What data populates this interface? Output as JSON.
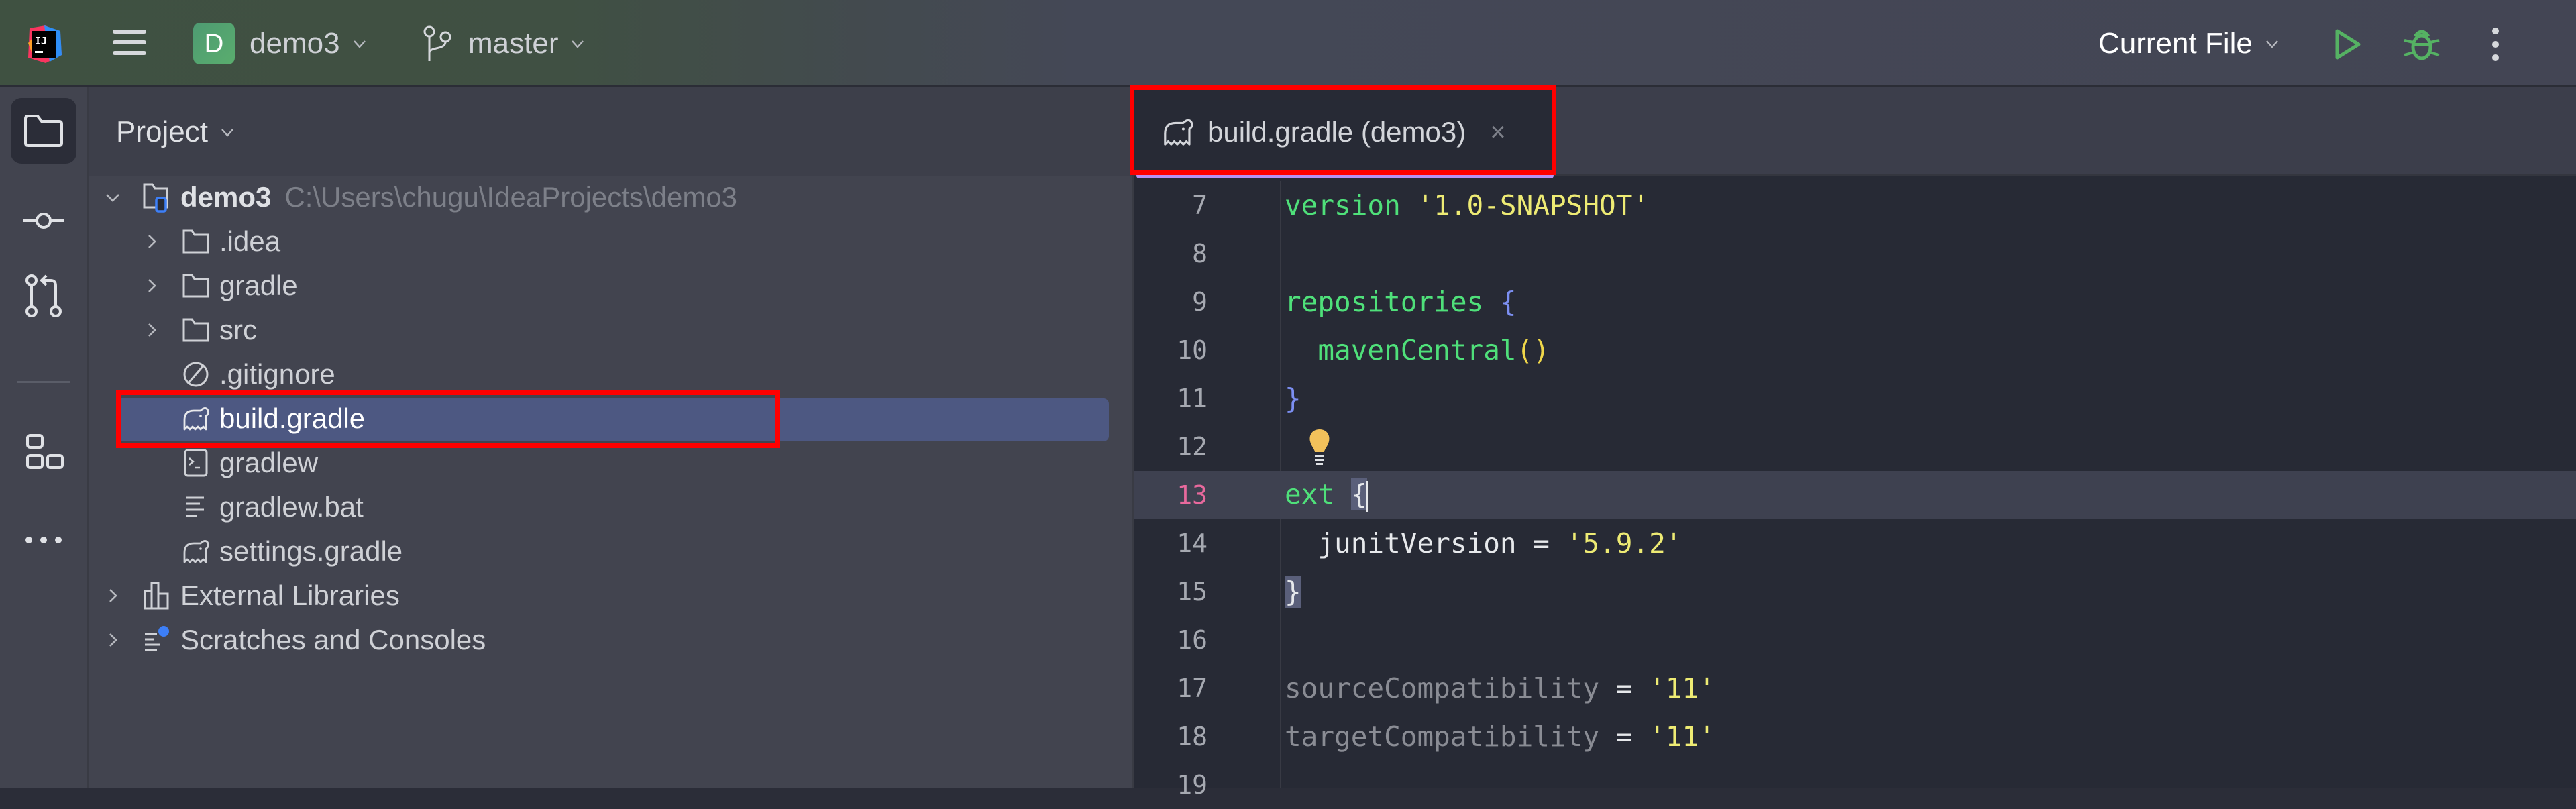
{
  "topbar": {
    "app_icon": "intellij-idea-logo",
    "menu_icon": "hamburger-menu-icon",
    "project": {
      "badge": "D",
      "name": "demo3",
      "badge_color": "#4e9b72"
    },
    "branch": {
      "icon": "git-branch-icon",
      "name": "master"
    },
    "run_config": {
      "label": "Current File"
    },
    "run_icon": "run-icon",
    "debug_icon": "debug-icon",
    "more_icon": "more-vertical-icon",
    "run_color": "#55b263"
  },
  "toolstrip": {
    "items": [
      {
        "name": "project",
        "icon": "folder-icon",
        "active": true
      },
      {
        "name": "commit",
        "icon": "commit-icon",
        "active": false
      },
      {
        "name": "pull-requests",
        "icon": "pull-request-icon",
        "active": false
      },
      {
        "name": "structure",
        "icon": "structure-icon",
        "active": false
      },
      {
        "name": "more",
        "icon": "more-horizontal-icon",
        "active": false
      }
    ]
  },
  "project_panel": {
    "title": "Project",
    "tree": [
      {
        "label": "demo3",
        "path": "C:\\Users\\chugu\\IdeaProjects\\demo3",
        "icon": "module-folder-icon",
        "expanded": true,
        "level": 0
      },
      {
        "label": ".idea",
        "icon": "folder-icon",
        "expandable": true,
        "level": 1
      },
      {
        "label": "gradle",
        "icon": "folder-icon",
        "expandable": true,
        "level": 1
      },
      {
        "label": "src",
        "icon": "folder-icon",
        "expandable": true,
        "level": 1
      },
      {
        "label": ".gitignore",
        "icon": "ignore-file-icon",
        "level": 1
      },
      {
        "label": "build.gradle",
        "icon": "gradle-icon",
        "level": 1,
        "selected": true
      },
      {
        "label": "gradlew",
        "icon": "shell-script-icon",
        "level": 1
      },
      {
        "label": "gradlew.bat",
        "icon": "text-file-icon",
        "level": 1
      },
      {
        "label": "settings.gradle",
        "icon": "gradle-icon",
        "level": 1
      },
      {
        "label": "External Libraries",
        "icon": "libraries-icon",
        "expandable": true,
        "level": 0
      },
      {
        "label": "Scratches and Consoles",
        "icon": "scratches-icon",
        "expandable": true,
        "level": 0
      }
    ],
    "selection_color": "#4d5882"
  },
  "editor": {
    "tab": {
      "label": "build.gradle (demo3)",
      "icon": "gradle-icon",
      "close": "×",
      "underline_color": "#b891f5"
    },
    "current_line": 13,
    "lines": [
      {
        "n": "7"
      },
      {
        "n": "8"
      },
      {
        "n": "9"
      },
      {
        "n": "10"
      },
      {
        "n": "11"
      },
      {
        "n": "12"
      },
      {
        "n": "13"
      },
      {
        "n": "14"
      },
      {
        "n": "15"
      },
      {
        "n": "16"
      },
      {
        "n": "17"
      },
      {
        "n": "18"
      },
      {
        "n": "19"
      }
    ],
    "code": {
      "l7_kw": "version",
      "l7_str": "'1.0-SNAPSHOT'",
      "l9_kw": "repositories",
      "l9_brace": "{",
      "l10_fn": "mavenCentral",
      "l10_paren": "()",
      "l11_brace": "}",
      "l13_kw": "ext",
      "l13_brace": "{",
      "l14_var": "junitVersion",
      "l14_eq": " = ",
      "l14_str": "'5.9.2'",
      "l15_brace": "}",
      "l17_var": "sourceCompatibility",
      "l17_eq": " = ",
      "l17_str": "'11'",
      "l18_var": "targetCompatibility",
      "l18_eq": " = ",
      "l18_str": "'11'"
    },
    "intention_icon": "lightbulb-icon"
  },
  "annotations": {
    "highlight_color": "#ff0000",
    "boxes": [
      "editor-tab-build-gradle",
      "tree-item-build-gradle"
    ]
  }
}
